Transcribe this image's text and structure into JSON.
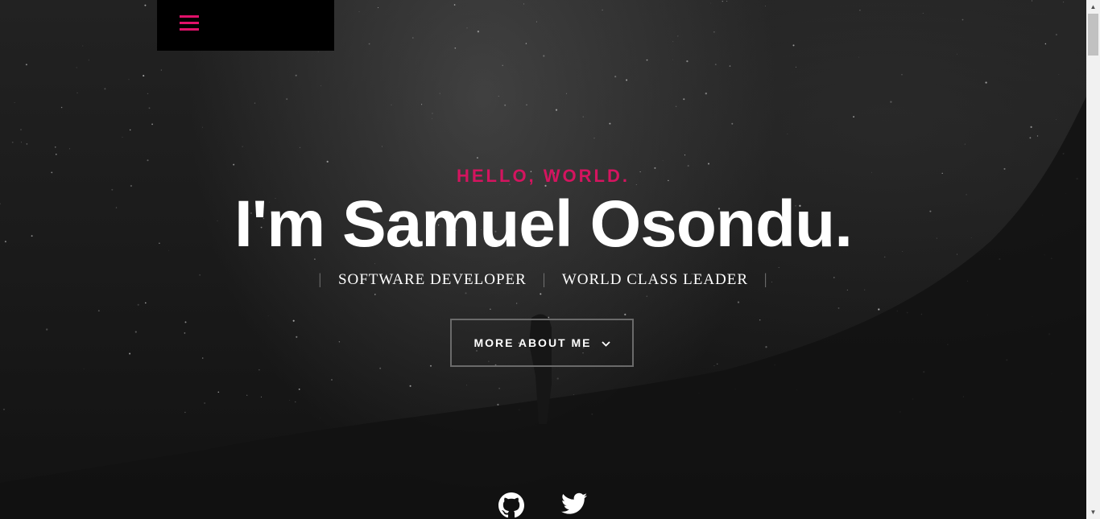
{
  "hero": {
    "greeting": "HELLO, WORLD.",
    "name": "I'm Samuel Osondu.",
    "roles": [
      "SOFTWARE DEVELOPER",
      "WORLD CLASS LEADER"
    ],
    "separator": "|",
    "cta_label": "MORE ABOUT ME",
    "cta_icon": "chevron-down-icon"
  },
  "nav": {
    "menu_icon": "hamburger-menu-icon"
  },
  "social": [
    {
      "icon": "github-icon"
    },
    {
      "icon": "twitter-icon"
    }
  ],
  "colors": {
    "accent": "#d4145f",
    "background": "#141414",
    "text": "#ffffff",
    "menu_box": "#000000"
  }
}
